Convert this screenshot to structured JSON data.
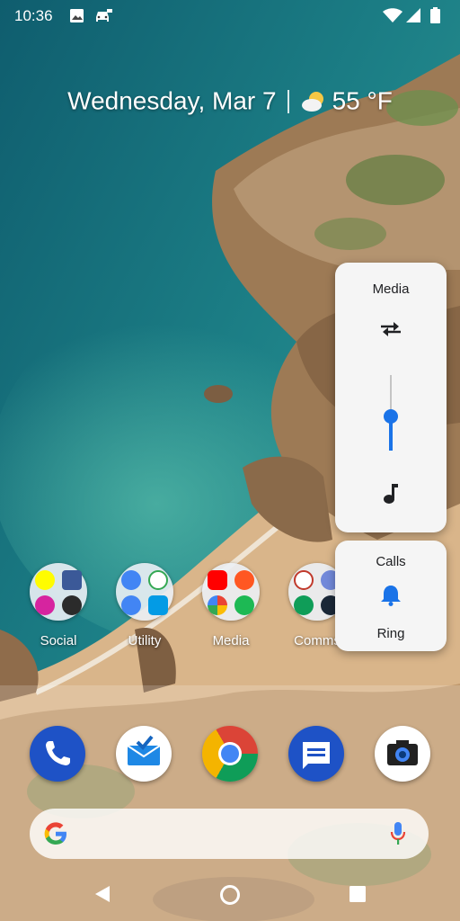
{
  "status_bar": {
    "time": "10:36",
    "left_icons": [
      "image-icon",
      "car-icon"
    ],
    "right_icons": [
      "wifi-icon",
      "signal-icon",
      "battery-icon"
    ]
  },
  "at_a_glance": {
    "date": "Wednesday, Mar 7",
    "weather_icon": "partly-sunny-icon",
    "temperature": "55 °F"
  },
  "folders": [
    {
      "label": "Social",
      "apps": [
        "snapchat",
        "facebook",
        "instagram",
        "paint"
      ]
    },
    {
      "label": "Utility",
      "apps": [
        "arrow",
        "drive",
        "translate",
        "files"
      ]
    },
    {
      "label": "Media",
      "apps": [
        "youtube",
        "play-music",
        "photos",
        "spotify"
      ]
    },
    {
      "label": "Comms",
      "apps": [
        "skype",
        "discord",
        "hangouts",
        "steam"
      ]
    }
  ],
  "dock_apps": [
    "phone",
    "inbox",
    "chrome",
    "messages",
    "camera"
  ],
  "search_bar": {
    "logo": "G",
    "mic": "mic-icon"
  },
  "volume_panel": {
    "media_label": "Media",
    "media_level": 0.45,
    "calls_label": "Calls",
    "ring_label": "Ring",
    "accent": "#1a73e8"
  },
  "nav_bar": {
    "icons": [
      "back-icon",
      "home-icon",
      "recents-icon"
    ]
  }
}
